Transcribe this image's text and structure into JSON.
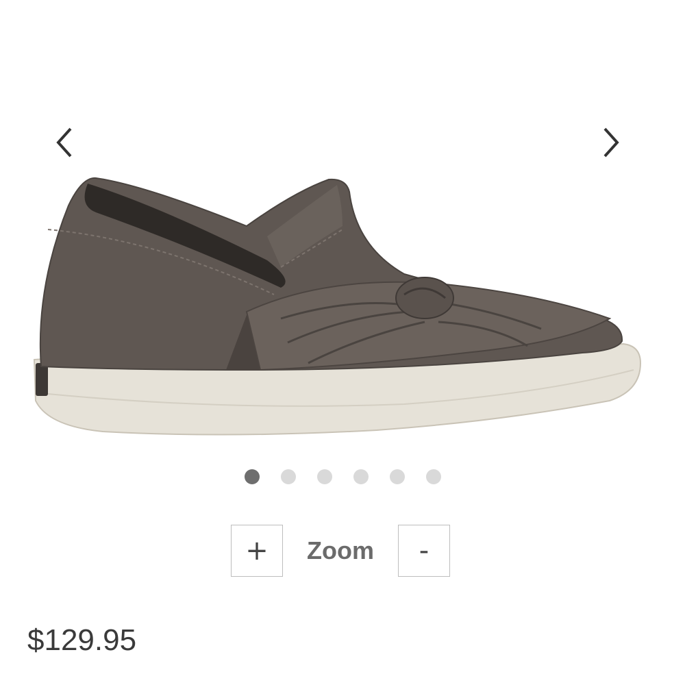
{
  "gallery": {
    "prev_icon": "chevron-left-icon",
    "next_icon": "chevron-right-icon",
    "image_alt": "",
    "slide_count": 6,
    "active_slide": 1
  },
  "zoom": {
    "plus_label": "+",
    "label": "Zoom",
    "minus_label": "-"
  },
  "product": {
    "price": "$129.95"
  },
  "colors": {
    "dot_active": "#6e6e6e",
    "dot_inactive": "#d9d9d9",
    "shoe_upper": "#5f5752",
    "shoe_sole": "#e6e2d8"
  }
}
